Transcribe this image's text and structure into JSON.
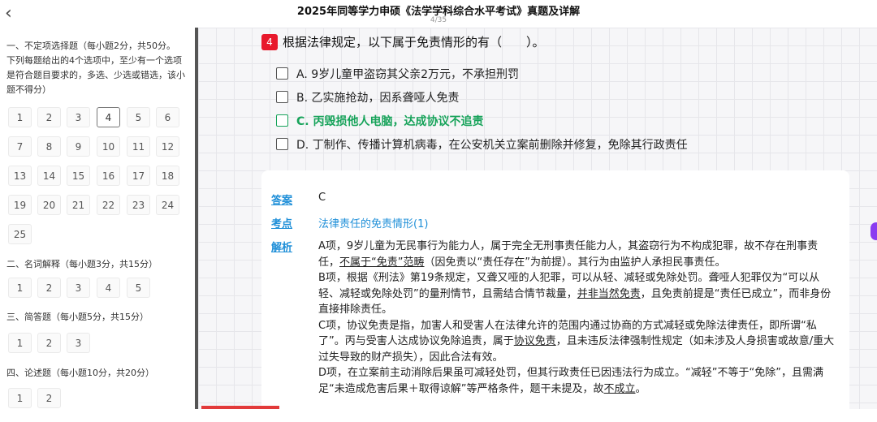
{
  "header": {
    "back_icon": "‹",
    "title": "2025年同等学力申硕《法学学科综合水平考试》真题及详解",
    "page": "4/35"
  },
  "sidebar": {
    "sections": [
      {
        "title": "一、不定项选择题（每小题2分，共50分。",
        "desc": "下列每题给出的4个选项中，至少有一个选项是符合题目要求的，多选、少选或错选，该小题不得分）",
        "numbers": [
          "1",
          "2",
          "3",
          "4",
          "5",
          "6",
          "7",
          "8",
          "9",
          "10",
          "11",
          "12",
          "13",
          "14",
          "15",
          "16",
          "17",
          "18",
          "19",
          "20",
          "21",
          "22",
          "23",
          "24",
          "25"
        ],
        "active": "4"
      },
      {
        "title": "二、名词解释（每小题3分，共15分）",
        "numbers": [
          "1",
          "2",
          "3",
          "4",
          "5"
        ]
      },
      {
        "title": "三、简答题（每小题5分，共15分）",
        "numbers": [
          "1",
          "2",
          "3"
        ]
      },
      {
        "title": "四、论述题（每小题10分，共20分）",
        "numbers": [
          "1",
          "2"
        ]
      }
    ]
  },
  "question": {
    "number": "4",
    "text": "根据法律规定，以下属于免责情形的有（　　）。",
    "options": [
      {
        "label": "A.",
        "text": "9岁儿童甲盗窃其父亲2万元，不承担刑罚"
      },
      {
        "label": "B.",
        "text": "乙实施抢劫，因系聋哑人免责"
      },
      {
        "label": "C.",
        "text": "丙毁损他人电脑，达成协议不追责"
      },
      {
        "label": "D.",
        "text": "丁制作、传播计算机病毒，在公安机关立案前删除并修复，免除其行政责任"
      }
    ]
  },
  "answer": {
    "answer_label": "答案",
    "answer_value": "C",
    "point_label": "考点",
    "point_value": "法律责任的免责情形(1)",
    "analysis_label": "解析",
    "paragraphs": {
      "a_1": "A项，9岁儿童为无民事行为能力人，属于完全无刑事责任能力人，其盗窃行为不构成犯罪，故不存在刑事责任，",
      "a_u": "不属于“免责”范畴",
      "a_2": "（因免责以“责任存在”为前提）。其行为由监护人承担民事责任。",
      "b_1": "B项，根据《刑法》第19条规定，又聋又哑的人犯罪，可以从轻、减轻或免除处罚。聋哑人犯罪仅为“可以从轻、减轻或免除处罚”的量刑情节，且需结合情节裁量，",
      "b_u": "并非当然免责",
      "b_2": "，且免责前提是“责任已成立”，而非身份直接排除责任。",
      "c_1": "C项，协议免责是指，加害人和受害人在法律允许的范围内通过协商的方式减轻或免除法律责任，即所谓“私了”。丙与受害人达成协议免除追责，属于",
      "c_u": "协议免责",
      "c_2": "，且未违反法律强制性规定（如未涉及人身损害或故意/重大过失导致的财产损失），因此合法有效。",
      "d_1": "D项，在立案前主动消除后果虽可减轻处罚，但其行政责任已因违法行为成立。“减轻”不等于“免除”，且需满足“未造成危害后果＋取得谅解”等严格条件，题干未提及，故",
      "d_u": "不成立",
      "d_2": "。"
    }
  },
  "colors": {
    "accent_red": "#e8192c",
    "correct_green": "#17a35a",
    "link_blue": "#1f8fd8",
    "side_handle": "#8a3cf0"
  }
}
